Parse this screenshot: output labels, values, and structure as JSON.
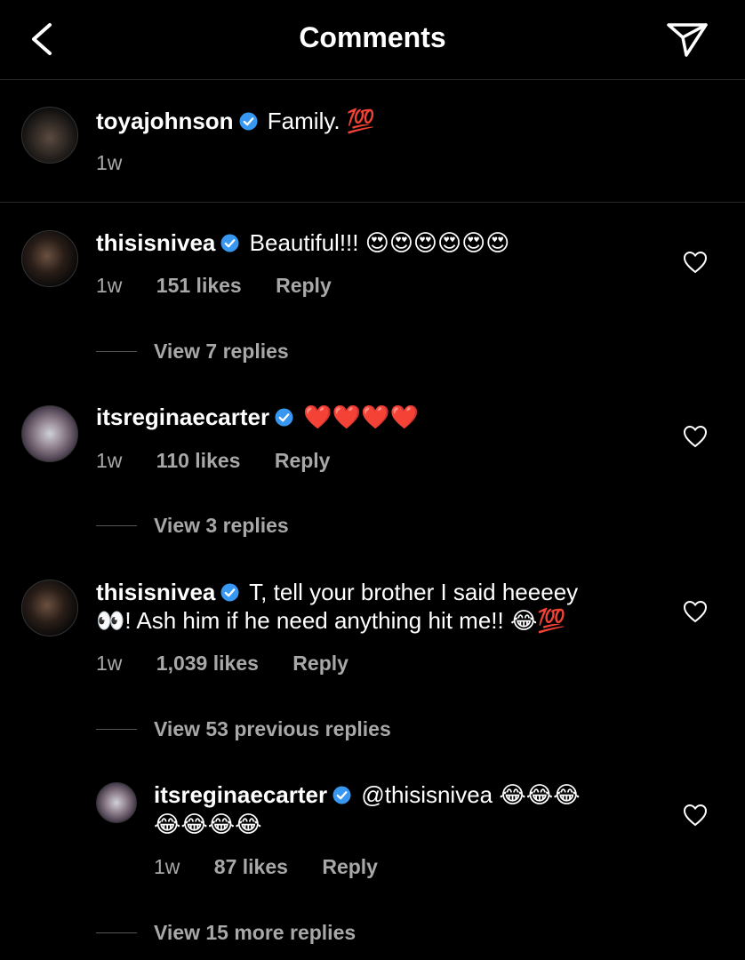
{
  "header": {
    "title": "Comments"
  },
  "caption": {
    "username": "toyajohnson",
    "text": "Family.",
    "emoji": "💯",
    "time": "1w"
  },
  "comments": [
    {
      "username": "thisisnivea",
      "text": "Beautiful!!! ",
      "emoji": "😍😍😍😍😍😍",
      "time": "1w",
      "likes": "151 likes",
      "reply": "Reply",
      "view_replies": "View 7 replies"
    },
    {
      "username": "itsreginaecarter",
      "text": "",
      "emoji": "❤️❤️❤️❤️",
      "time": "1w",
      "likes": "110 likes",
      "reply": "Reply",
      "view_replies": "View 3 replies"
    },
    {
      "username": "thisisnivea",
      "text_line1": "T, tell your brother I said heeeey",
      "text_line2_emoji_start": "👀",
      "text_line2": "! Ash him if he need anything hit me!! ",
      "text_line2_emoji_end": "😂💯",
      "time": "1w",
      "likes": "1,039 likes",
      "reply": "Reply",
      "view_replies": "View 53 previous replies"
    }
  ],
  "reply": {
    "username": "itsreginaecarter",
    "mention": "@thisisnivea ",
    "emoji_line1": "😂😂😂",
    "emoji_line2": "😂😂😂😂",
    "time": "1w",
    "likes": "87 likes",
    "reply": "Reply",
    "view_replies": "View 15 more replies"
  }
}
